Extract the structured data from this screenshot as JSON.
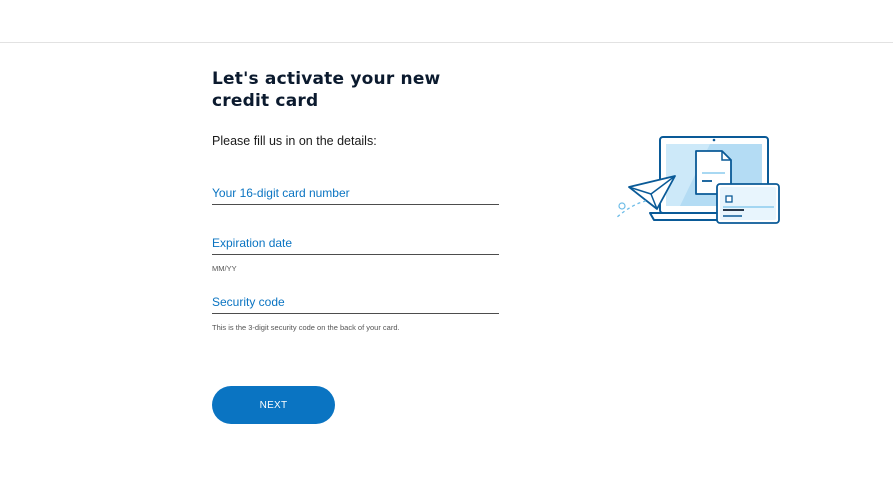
{
  "header": {},
  "form": {
    "title": "Let's activate your new credit card",
    "subtitle": "Please fill us in on the details:",
    "fields": [
      {
        "label": "Your 16-digit card number",
        "value": "",
        "hint": ""
      },
      {
        "label": "Expiration date",
        "value": "",
        "hint": "MM/YY"
      },
      {
        "label": "Security code",
        "value": "",
        "hint": "This is the 3-digit security code on the back of your card."
      }
    ],
    "next_label": "NEXT"
  },
  "colors": {
    "accent": "#0a74c2",
    "title": "#0b1a2e",
    "illustration_light": "#cde9f9"
  },
  "illustration": {
    "icon": "laptop-card-paper-plane-illustration"
  }
}
